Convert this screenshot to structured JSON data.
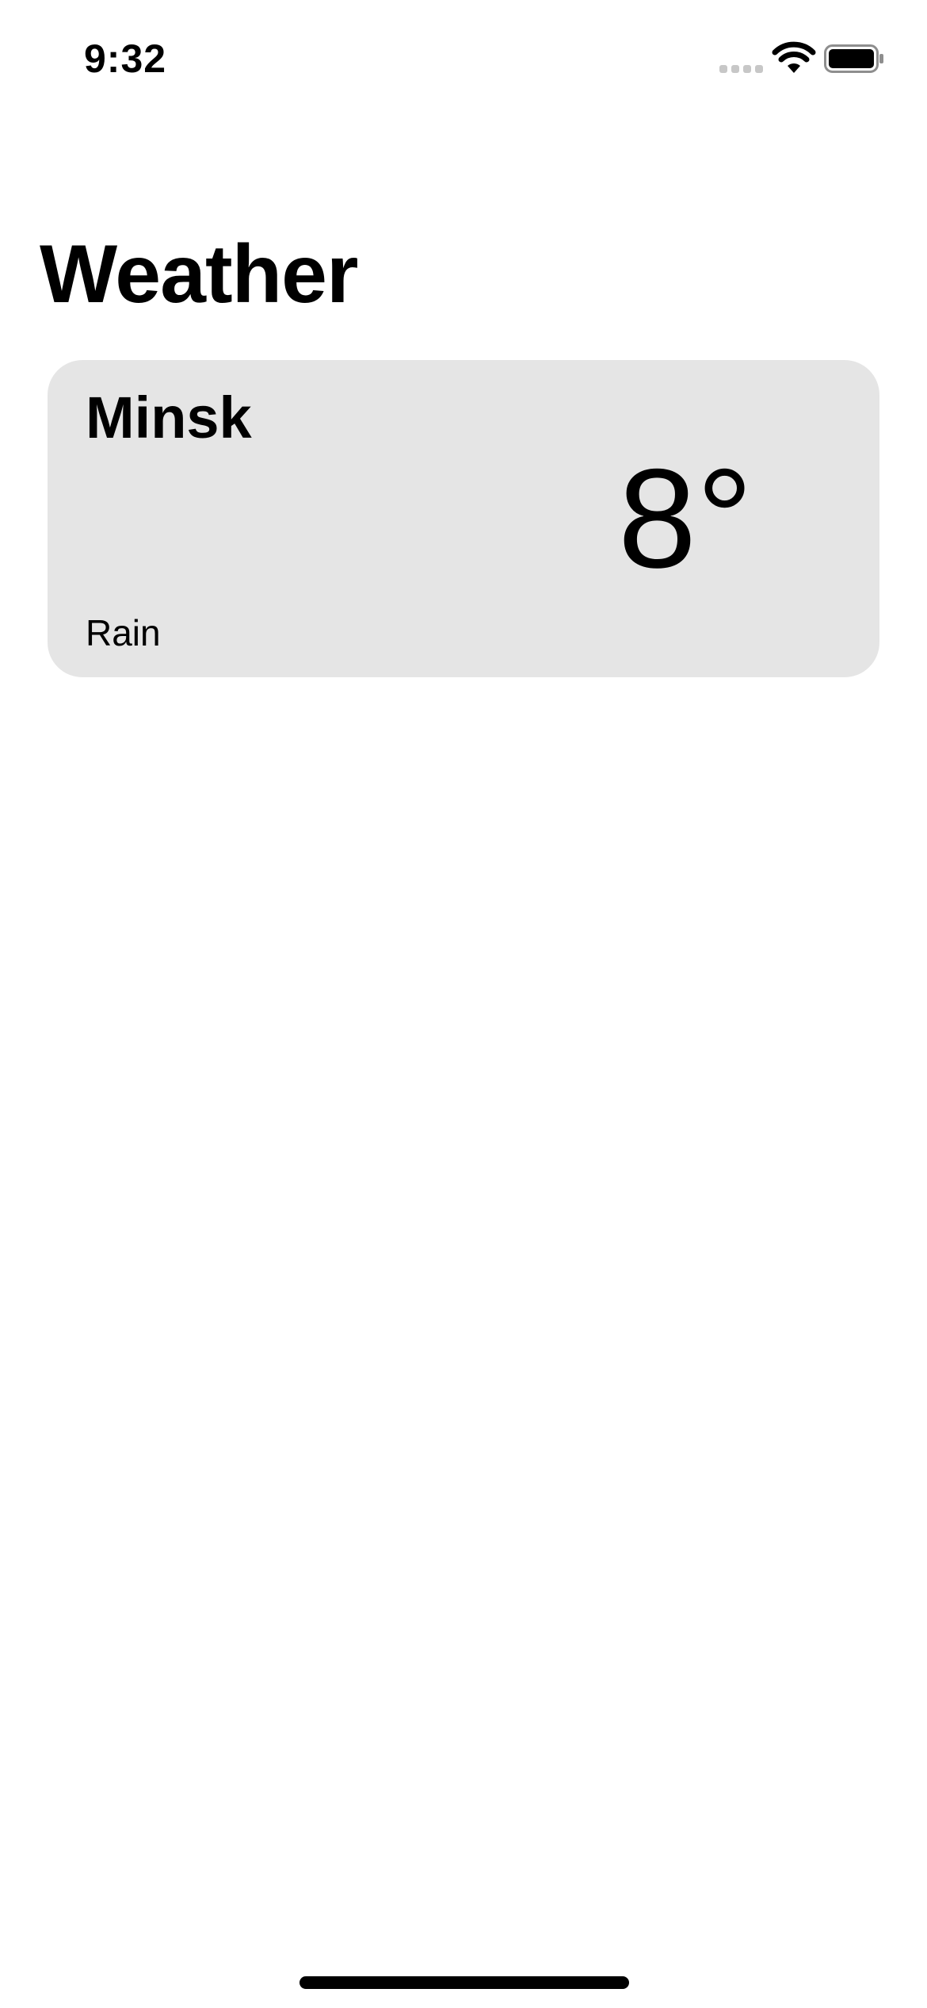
{
  "status_bar": {
    "time": "9:32",
    "icons": [
      "cellular-signal-icon",
      "wifi-icon",
      "battery-icon"
    ]
  },
  "header": {
    "title": "Weather"
  },
  "cards": [
    {
      "city": "Minsk",
      "temperature": "8°",
      "condition": "Rain",
      "background": "#e5e5e5"
    }
  ],
  "colors": {
    "background": "#ffffff",
    "text": "#000000",
    "card": "#e5e5e5"
  }
}
